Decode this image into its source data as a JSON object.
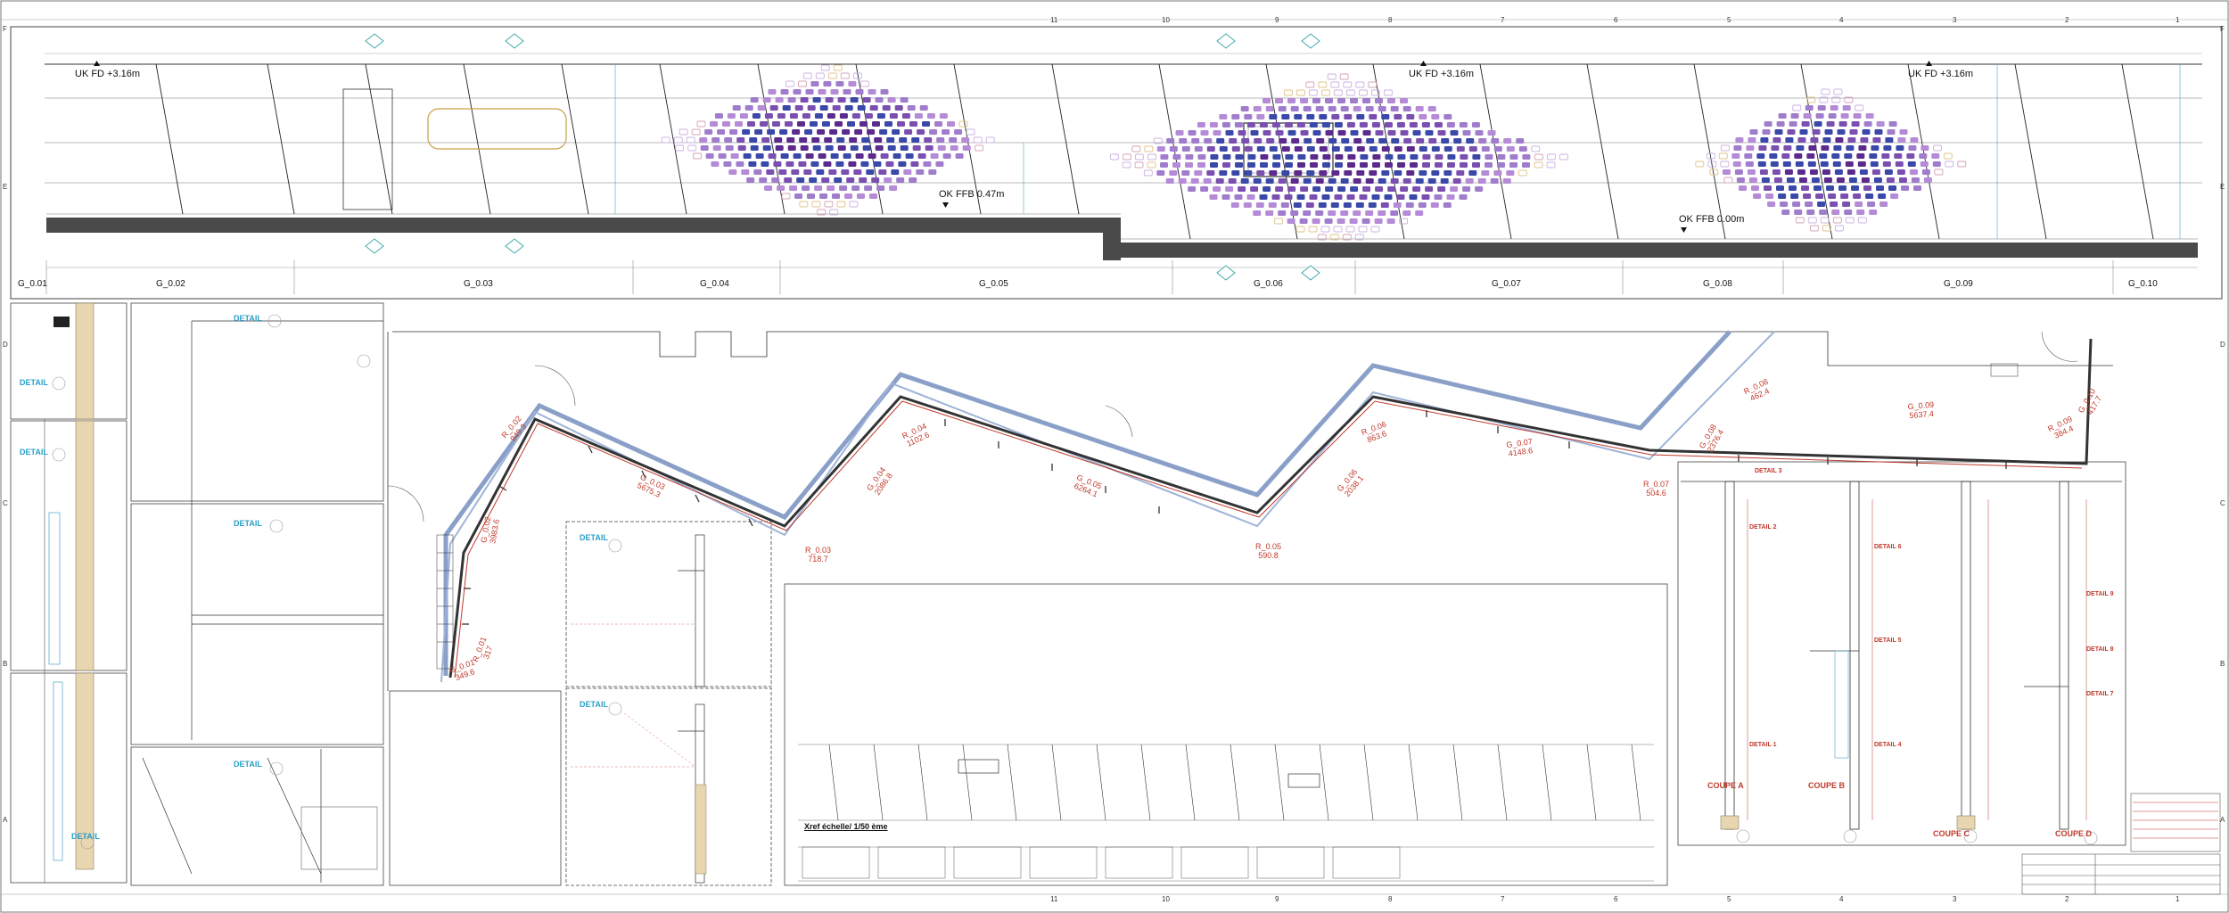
{
  "grid": {
    "columns": [
      "11",
      "10",
      "9",
      "8",
      "7",
      "6",
      "5",
      "4",
      "3",
      "2",
      "1"
    ],
    "rows": [
      "F",
      "E",
      "D",
      "C",
      "B",
      "A"
    ]
  },
  "elevation": {
    "levels": [
      {
        "id": "uk-left",
        "label": "UK FD +3.16m"
      },
      {
        "id": "uk-mid",
        "label": "UK FD +3.16m"
      },
      {
        "id": "uk-right",
        "label": "UK FD +3.16m"
      },
      {
        "id": "ok-047",
        "label": "OK FFB 0.47m"
      },
      {
        "id": "ok-000",
        "label": "OK FFB 0.00m"
      }
    ],
    "zones": [
      "G_0.01",
      "G_0.02",
      "G_0.03",
      "G_0.04",
      "G_0.05",
      "G_0.06",
      "G_0.07",
      "G_0.08",
      "G_0.09",
      "G_0.10"
    ],
    "pattern_colors": [
      "#5b2a8c",
      "#7a4fb0",
      "#a07ccc",
      "#c9b3e0",
      "#3a48a8",
      "#b58ad6",
      "#e0c48a",
      "#d6a3b8"
    ]
  },
  "details": {
    "left": [
      "DETAIL",
      "DETAIL",
      "DETAIL",
      "DETAIL",
      "DETAIL",
      "DETAIL",
      "DETAIL",
      "DETAIL"
    ],
    "right": [
      "DETAIL 1",
      "DETAIL 2",
      "DETAIL 3",
      "DETAIL 4",
      "DETAIL 5",
      "DETAIL 6",
      "DETAIL 7",
      "DETAIL 8",
      "DETAIL 9"
    ]
  },
  "plan": {
    "segments": [
      {
        "id": "g001",
        "line1": "G_0.01",
        "line2": "349.6"
      },
      {
        "id": "r001",
        "line1": "R_0.01",
        "line2": "317"
      },
      {
        "id": "g002",
        "line1": "G_0.02",
        "line2": "3983.6"
      },
      {
        "id": "r002",
        "line1": "R_0.02",
        "line2": "949.3"
      },
      {
        "id": "g003",
        "line1": "G_0.03",
        "line2": "5675.3"
      },
      {
        "id": "r003",
        "line1": "R_0.03",
        "line2": "718.7"
      },
      {
        "id": "g004",
        "line1": "G_0.04",
        "line2": "2086.8"
      },
      {
        "id": "r004",
        "line1": "R_0.04",
        "line2": "1102.6"
      },
      {
        "id": "g005",
        "line1": "G_0.05",
        "line2": "6264.1"
      },
      {
        "id": "r005",
        "line1": "R_0.05",
        "line2": "590.8"
      },
      {
        "id": "g006",
        "line1": "G_0.06",
        "line2": "2038.1"
      },
      {
        "id": "r006",
        "line1": "R_0.06",
        "line2": "863.6"
      },
      {
        "id": "g007",
        "line1": "G_0.07",
        "line2": "4148.6"
      },
      {
        "id": "r007",
        "line1": "R_0.07",
        "line2": "504.6"
      },
      {
        "id": "g008",
        "line1": "G_0.08",
        "line2": "2376.4"
      },
      {
        "id": "r008",
        "line1": "R_0.08",
        "line2": "462.4"
      },
      {
        "id": "g009",
        "line1": "G_0.09",
        "line2": "5637.4"
      },
      {
        "id": "r009",
        "line1": "R_0.09",
        "line2": "384.4"
      },
      {
        "id": "g010",
        "line1": "G_0.10",
        "line2": "417.7"
      }
    ]
  },
  "xref": {
    "title": "Xref échelle/ 1/50 ème"
  },
  "sections": [
    "COUPE",
    "COUPE",
    "COUPE",
    "COUPE"
  ],
  "section_letters": [
    "A",
    "B",
    "C",
    "D"
  ]
}
